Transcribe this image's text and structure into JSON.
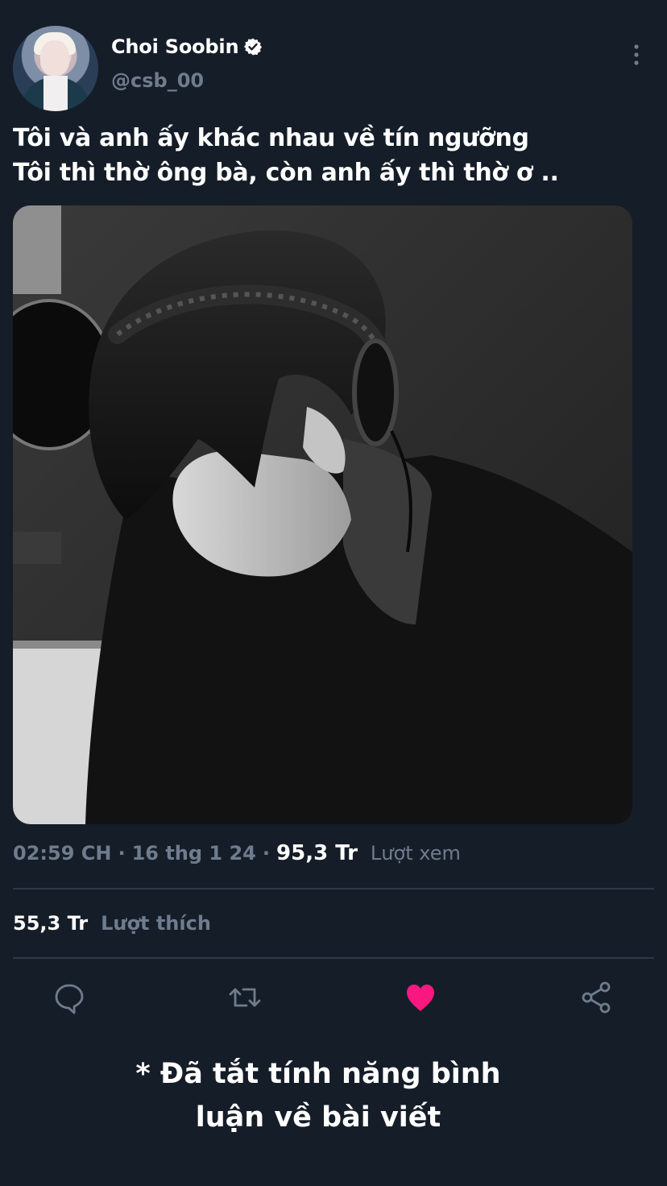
{
  "author": {
    "display_name": "Choi Soobin",
    "handle": "@csb_00",
    "verified": true
  },
  "tweet": {
    "text": "Tôi và anh ấy khác nhau về tín ngưỡng\nTôi thì thờ ông bà, còn anh ấy thì thờ ơ ..",
    "timestamp": "02:59 CH",
    "date": "16 thg 1 24",
    "views_count": "95,3 Tr",
    "views_label": "Lượt xem",
    "separator": "·"
  },
  "stats": {
    "likes_count": "55,3 Tr",
    "likes_label": "Lượt thích"
  },
  "actions": {
    "reply_icon": "reply-icon",
    "retweet_icon": "retweet-icon",
    "like_icon": "heart-icon",
    "share_icon": "share-icon",
    "like_active": true
  },
  "footer": {
    "note": "* Đã tắt tính năng bình\nluận về bài viết"
  },
  "colors": {
    "background": "#151d28",
    "text": "#ffffff",
    "muted": "#6f7c8e",
    "like": "#f91880",
    "divider": "#2e3946"
  },
  "icons": {
    "verified": "verified-badge-icon",
    "more": "more-vertical-icon"
  }
}
